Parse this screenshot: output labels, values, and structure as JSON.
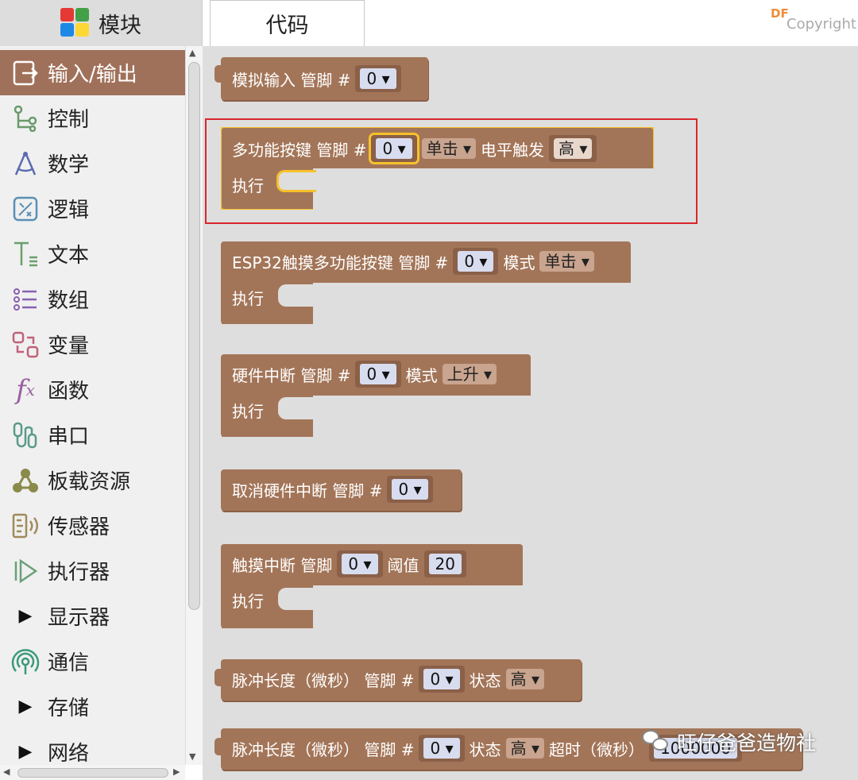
{
  "tabs": {
    "blocks": "模块",
    "code": "代码"
  },
  "watermark": {
    "brand": "DF",
    "copyright": "Copyright",
    "wechat_account": "旺仔爸爸造物社"
  },
  "sidebar": {
    "items": [
      {
        "label": "输入/输出",
        "icon": "io-icon",
        "selected": true
      },
      {
        "label": "控制",
        "icon": "control-flow-icon"
      },
      {
        "label": "数学",
        "icon": "compass-icon"
      },
      {
        "label": "逻辑",
        "icon": "logic-icon"
      },
      {
        "label": "文本",
        "icon": "text-icon"
      },
      {
        "label": "数组",
        "icon": "list-icon"
      },
      {
        "label": "变量",
        "icon": "variable-icon"
      },
      {
        "label": "函数",
        "icon": "function-icon"
      },
      {
        "label": "串口",
        "icon": "serial-icon"
      },
      {
        "label": "板载资源",
        "icon": "board-resource-icon"
      },
      {
        "label": "传感器",
        "icon": "sensor-icon"
      },
      {
        "label": "执行器",
        "icon": "actuator-icon"
      },
      {
        "label": "显示器",
        "icon": "expand-triangle-icon"
      },
      {
        "label": "通信",
        "icon": "communication-icon"
      },
      {
        "label": "存储",
        "icon": "expand-triangle-icon"
      },
      {
        "label": "网络",
        "icon": "expand-triangle-icon"
      }
    ]
  },
  "blocks": {
    "analog_read": {
      "label": "模拟输入 管脚 #",
      "pin": "0"
    },
    "multi_button": {
      "label": "多功能按键 管脚 #",
      "pin": "0",
      "mode": "单击",
      "level_label": "电平触发",
      "level": "高",
      "exec": "执行"
    },
    "touch_multi_button": {
      "label": "ESP32触摸多功能按键 管脚 #",
      "pin": "0",
      "mode_label": "模式",
      "mode": "单击",
      "exec": "执行"
    },
    "hw_interrupt": {
      "label": "硬件中断 管脚 #",
      "pin": "0",
      "mode_label": "模式",
      "mode": "上升",
      "exec": "执行"
    },
    "cancel_interrupt": {
      "label": "取消硬件中断 管脚 #",
      "pin": "0"
    },
    "touch_interrupt": {
      "label": "触摸中断 管脚",
      "pin": "0",
      "threshold_label": "阈值",
      "threshold": "20",
      "exec": "执行"
    },
    "pulse_in": {
      "label": "脉冲长度（微秒） 管脚 #",
      "pin": "0",
      "state_label": "状态",
      "state": "高"
    },
    "pulse_in_timeout": {
      "label": "脉冲长度（微秒） 管脚 #",
      "pin": "0",
      "state_label": "状态",
      "state": "高",
      "timeout_label": "超时（微秒）",
      "timeout": "1000000"
    }
  },
  "colors": {
    "block": "#a37558",
    "selected_category": "#a0715a",
    "highlight": "#f7c12b",
    "annotation": "#d9262c"
  }
}
